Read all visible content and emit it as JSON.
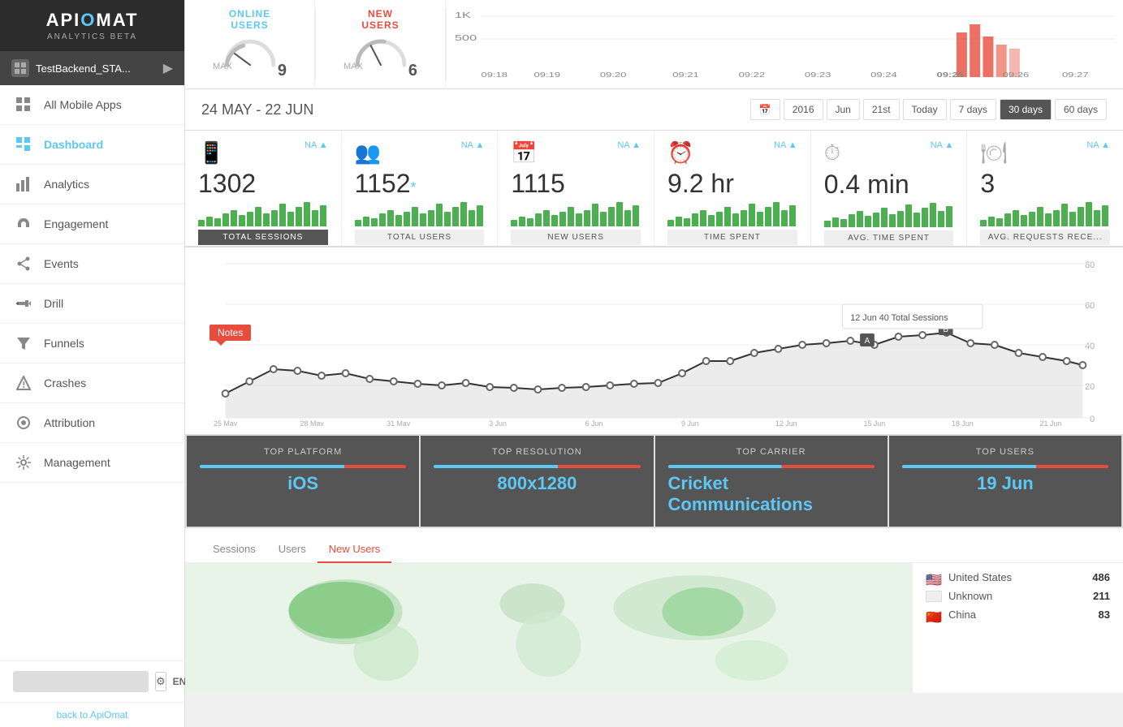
{
  "app": {
    "logo": "APIOMAT",
    "subtitle": "ANALYTICS BETA",
    "appName": "TestBackend_STA..."
  },
  "nav": {
    "items": [
      {
        "id": "all-apps",
        "label": "All Mobile Apps",
        "icon": "grid"
      },
      {
        "id": "dashboard",
        "label": "Dashboard",
        "icon": "dashboard",
        "active": true
      },
      {
        "id": "analytics",
        "label": "Analytics",
        "icon": "chart"
      },
      {
        "id": "engagement",
        "label": "Engagement",
        "icon": "magnet"
      },
      {
        "id": "events",
        "label": "Events",
        "icon": "share"
      },
      {
        "id": "drill",
        "label": "Drill",
        "icon": "drill"
      },
      {
        "id": "funnels",
        "label": "Funnels",
        "icon": "filter"
      },
      {
        "id": "crashes",
        "label": "Crashes",
        "icon": "warning"
      },
      {
        "id": "attribution",
        "label": "Attribution",
        "icon": "attribution"
      },
      {
        "id": "management",
        "label": "Management",
        "icon": "gear"
      }
    ],
    "search_placeholder": "",
    "lang": "EN",
    "back_link": "back to ApiOmat"
  },
  "topbar": {
    "online_users_label": "ONLINE\nUSERS",
    "online_max_label": "MAX",
    "online_max_val": "9",
    "new_users_label": "NEW\nUSERS",
    "new_max_label": "MAX",
    "new_max_val": "6",
    "sparkline_labels": [
      "09:18",
      "09:19",
      "09:20",
      "09:21",
      "09:22",
      "09:23",
      "09:24",
      "09:25",
      "09:26",
      "09:27"
    ],
    "sparkline_vals_1k": "1K",
    "sparkline_vals_500": "500"
  },
  "date_range": {
    "label": "24 MAY - 22 JUN",
    "buttons": [
      "2016",
      "Jun",
      "21st",
      "Today",
      "7 days",
      "30 days",
      "60 days"
    ],
    "active_btn": "30 days"
  },
  "metrics": [
    {
      "icon": "📱",
      "value": "1302",
      "label": "TOTAL SESSIONS",
      "active": true,
      "bars": [
        3,
        5,
        4,
        6,
        8,
        5,
        7,
        9,
        6,
        8,
        10,
        7,
        9,
        11,
        8,
        10
      ]
    },
    {
      "icon": "👥",
      "value": "1152",
      "star": true,
      "label": "TOTAL USERS",
      "active": false,
      "bars": [
        3,
        5,
        4,
        6,
        8,
        5,
        7,
        9,
        6,
        8,
        10,
        7,
        9,
        11,
        8,
        10
      ]
    },
    {
      "icon": "📅",
      "value": "1115",
      "label": "NEW USERS",
      "active": false,
      "bars": [
        3,
        5,
        4,
        6,
        8,
        5,
        7,
        9,
        6,
        8,
        10,
        7,
        9,
        11,
        8,
        10
      ]
    },
    {
      "icon": "⏰",
      "value": "9.2 hr",
      "label": "TIME SPENT",
      "active": false,
      "bars": [
        3,
        5,
        4,
        6,
        8,
        5,
        7,
        9,
        6,
        8,
        10,
        7,
        9,
        11,
        8,
        10
      ]
    },
    {
      "icon": "⏱",
      "value": "0.4 min",
      "label": "AVG. TIME SPENT",
      "active": false,
      "bars": [
        3,
        5,
        4,
        6,
        8,
        5,
        7,
        9,
        6,
        8,
        10,
        7,
        9,
        11,
        8,
        10
      ]
    },
    {
      "icon": "🍽",
      "value": "3",
      "label": "AVG. REQUESTS RECE...",
      "active": false,
      "bars": [
        3,
        5,
        4,
        6,
        8,
        5,
        7,
        9,
        6,
        8,
        10,
        7,
        9,
        11,
        8,
        10
      ]
    }
  ],
  "chart": {
    "x_labels": [
      "25 May",
      "28 May",
      "31 May",
      "3 Jun",
      "6 Jun",
      "9 Jun",
      "12 Jun",
      "15 Jun",
      "18 Jun",
      "21 Jun"
    ],
    "y_labels": [
      "0",
      "20",
      "40",
      "60",
      "80"
    ],
    "notes_label": "Notes",
    "tooltip_text": "12 Jun   40 Total Sessions",
    "label_a": "A",
    "label_b": "B"
  },
  "bottom_stats": [
    {
      "label": "TOP PLATFORM",
      "value": "iOS",
      "bar_blue": 70,
      "bar_red": 30
    },
    {
      "label": "TOP RESOLUTION",
      "value": "800x1280",
      "bar_blue": 60,
      "bar_red": 40
    },
    {
      "label": "TOP CARRIER",
      "value": "Cricket Communications",
      "bar_blue": 55,
      "bar_red": 45
    },
    {
      "label": "TOP USERS",
      "value": "19 Jun",
      "bar_blue": 65,
      "bar_red": 35
    }
  ],
  "geo": {
    "tabs": [
      "Sessions",
      "Users",
      "New Users"
    ],
    "active_tab": "New Users",
    "countries": [
      {
        "flag": "🇺🇸",
        "name": "United States",
        "count": "486"
      },
      {
        "flag": "⬜",
        "name": "Unknown",
        "count": "211"
      },
      {
        "flag": "🇨🇳",
        "name": "China",
        "count": "83"
      }
    ]
  }
}
